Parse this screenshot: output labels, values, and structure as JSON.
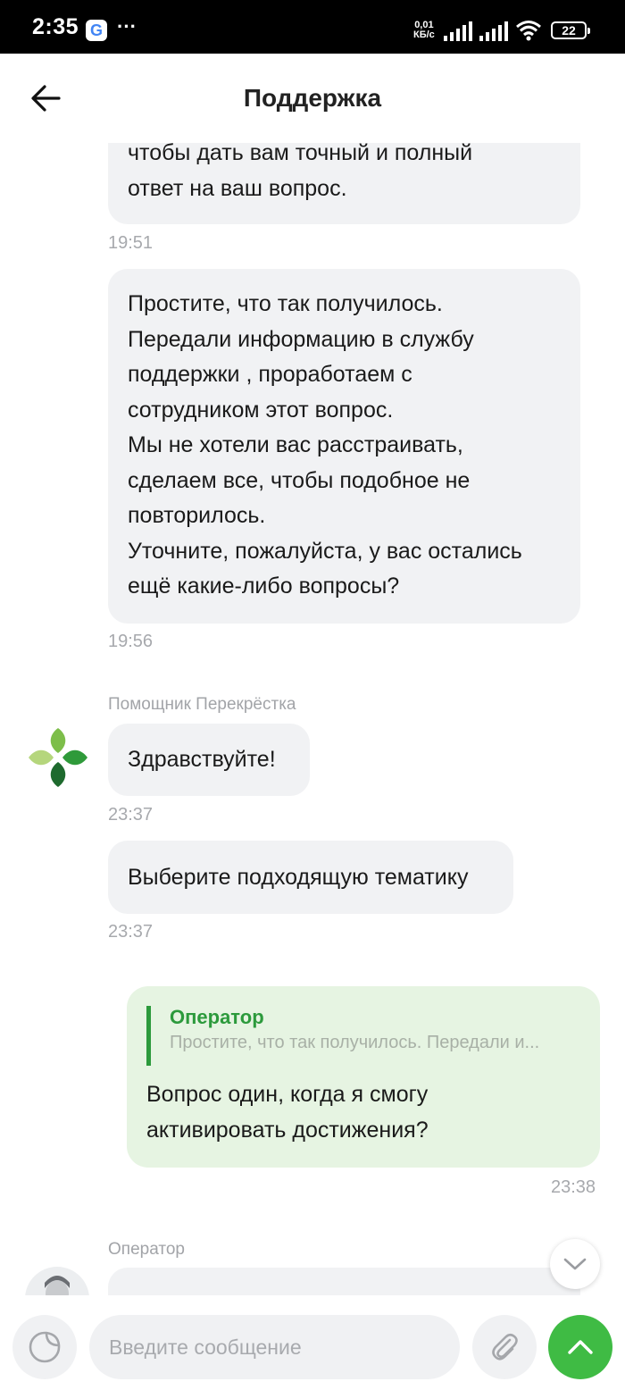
{
  "status_bar": {
    "time": "2:35",
    "google_badge": "G",
    "more": "···",
    "speed_value": "0,01",
    "speed_unit": "КБ/с",
    "battery": "22"
  },
  "header": {
    "title": "Поддержка"
  },
  "messages": {
    "m1": {
      "lines": [
        "чтобы дать вам точный и полный",
        "ответ на ваш вопрос."
      ],
      "time": "19:51"
    },
    "m2": {
      "lines": [
        "Простите, что так получилось.",
        "Передали информацию в службу",
        "поддержки , проработаем с",
        "сотрудником этот вопрос.",
        "Мы не хотели вас расстраивать,",
        "сделаем все, чтобы подобное не",
        "повторилось.",
        "Уточните, пожалуйста, у вас остались",
        "ещё какие-либо вопросы?"
      ],
      "time": "19:56"
    },
    "bot_sender": "Помощник Перекрёстка",
    "m3": {
      "text": "Здравствуйте!",
      "time": "23:37"
    },
    "m4": {
      "text": "Выберите подходящую тематику",
      "time": "23:37"
    },
    "outgoing": {
      "quote_title": "Оператор",
      "quote_text": "Простите, что так получилось. Передали и...",
      "lines": [
        "Вопрос один, когда я смогу",
        "активировать достижения?"
      ],
      "time": "23:38"
    },
    "operator_sender": "Оператор"
  },
  "input": {
    "placeholder": "Введите сообщение"
  },
  "colors": {
    "accent_green": "#3fbb44",
    "quote_green": "#2c9a3c",
    "outgoing_bg": "#e6f4e2",
    "incoming_bg": "#f1f2f4"
  }
}
